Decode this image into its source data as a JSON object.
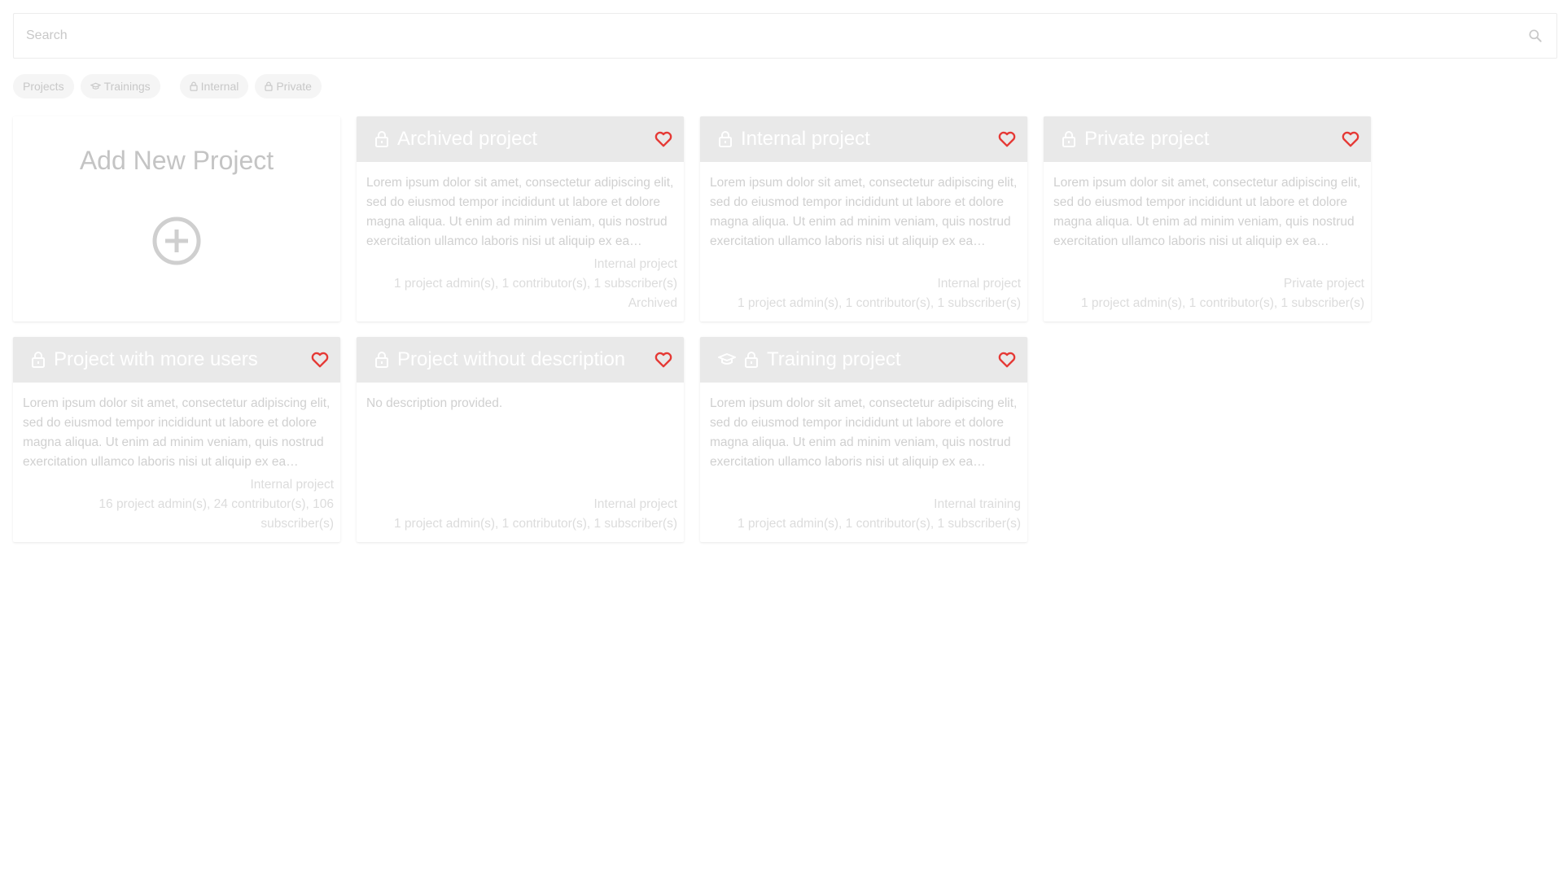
{
  "search": {
    "placeholder": "Search"
  },
  "filters": [
    {
      "label": "Projects",
      "icon": "none"
    },
    {
      "label": "Trainings",
      "icon": "graduation-cap-icon"
    },
    {
      "label": "Internal",
      "icon": "lock-icon"
    },
    {
      "label": "Private",
      "icon": "lock-icon"
    }
  ],
  "add_card": {
    "title": "Add New Project"
  },
  "colors": {
    "favorite": "#e53935",
    "header": "#e9e9e9"
  },
  "cards": [
    {
      "title": "Archived project",
      "description": "Lorem ipsum dolor sit amet, consectetur adipiscing elit, sed do eiusmod tempor incididunt ut labore et dolore magna aliqua. Ut enim ad minim veniam, quis nostrud exercitation ullamco laboris nisi ut aliquip ex ea commodo consequat.",
      "type": "Internal project",
      "members": "1 project admin(s), 1 contributor(s), 1 subscriber(s)",
      "status": "Archived"
    },
    {
      "title": "Internal project",
      "description": "Lorem ipsum dolor sit amet, consectetur adipiscing elit, sed do eiusmod tempor incididunt ut labore et dolore magna aliqua. Ut enim ad minim veniam, quis nostrud exercitation ullamco laboris nisi ut aliquip ex ea commodo consequat.",
      "type": "Internal project",
      "members": "1 project admin(s), 1 contributor(s), 1 subscriber(s)",
      "status": ""
    },
    {
      "title": "Private project",
      "description": "Lorem ipsum dolor sit amet, consectetur adipiscing elit, sed do eiusmod tempor incididunt ut labore et dolore magna aliqua. Ut enim ad minim veniam, quis nostrud exercitation ullamco laboris nisi ut aliquip ex ea commodo consequat.",
      "type": "Private project",
      "members": "1 project admin(s), 1 contributor(s), 1 subscriber(s)",
      "status": ""
    },
    {
      "title": "Project with more users",
      "description": "Lorem ipsum dolor sit amet, consectetur adipiscing elit, sed do eiusmod tempor incididunt ut labore et dolore magna aliqua. Ut enim ad minim veniam, quis nostrud exercitation ullamco laboris nisi ut aliquip ex ea commodo consequat.",
      "type": "Internal project",
      "members": "16 project admin(s), 24 contributor(s), 106 subscriber(s)",
      "status": ""
    },
    {
      "title": "Project without description",
      "description": "No description provided.",
      "type": "Internal project",
      "members": "1 project admin(s), 1 contributor(s), 1 subscriber(s)",
      "status": ""
    },
    {
      "title": "Training project",
      "description": "Lorem ipsum dolor sit amet, consectetur adipiscing elit, sed do eiusmod tempor incididunt ut labore et dolore magna aliqua. Ut enim ad minim veniam, quis nostrud exercitation ullamco laboris nisi ut aliquip ex ea commodo consequat.",
      "type": "Internal training",
      "members": "1 project admin(s), 1 contributor(s), 1 subscriber(s)",
      "status": ""
    }
  ]
}
